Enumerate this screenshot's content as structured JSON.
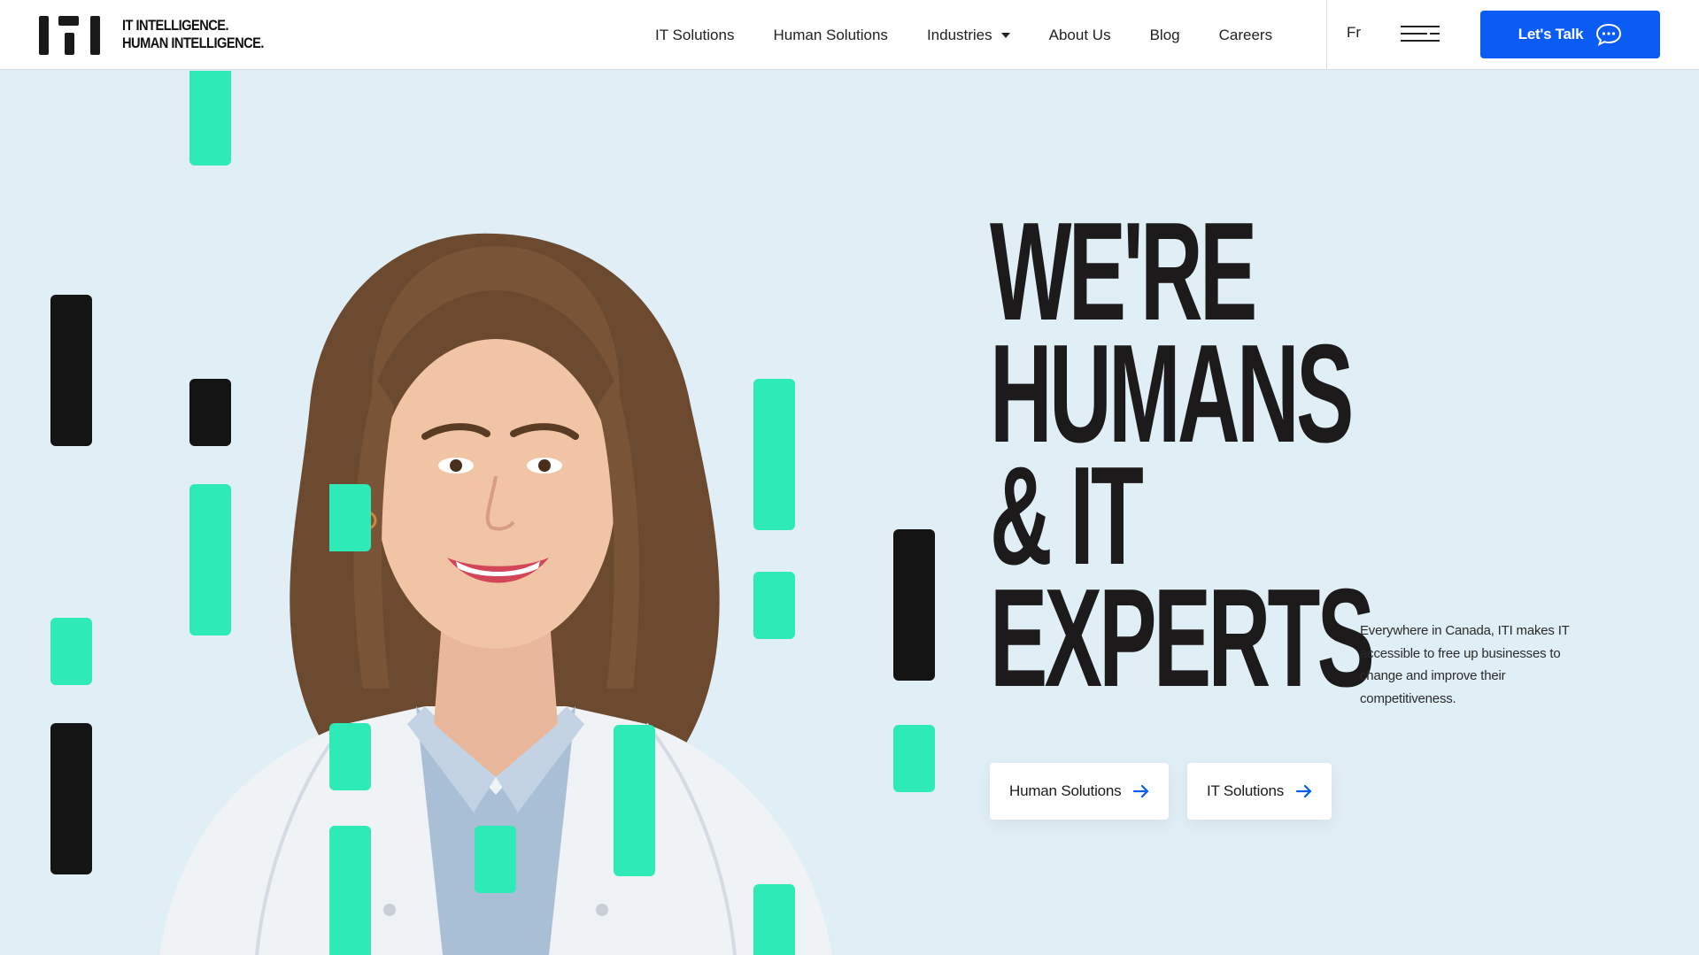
{
  "brand": {
    "line1": "IT INTELLIGENCE.",
    "line2": "HUMAN INTELLIGENCE."
  },
  "nav": {
    "items": [
      {
        "label": "IT Solutions"
      },
      {
        "label": "Human Solutions"
      },
      {
        "label": "Industries",
        "has_dropdown": true
      },
      {
        "label": "About Us"
      },
      {
        "label": "Blog"
      },
      {
        "label": "Careers"
      }
    ],
    "language": "Fr",
    "menu_icon": "hamburger-icon",
    "cta_label": "Let's Talk",
    "cta_icon": "chat-bubble-icon"
  },
  "hero": {
    "headline": [
      "WE'RE",
      "HUMANS",
      "& IT",
      "EXPERTS"
    ],
    "tagline": "Everywhere in Canada, ITI makes IT accessible to free up businesses to change and improve their competitiveness.",
    "buttons": [
      {
        "label": "Human Solutions",
        "icon": "arrow-right-icon"
      },
      {
        "label": "IT Solutions",
        "icon": "arrow-right-icon"
      }
    ]
  },
  "colors": {
    "accent_blue": "#0b5cf5",
    "mint": "#2eeab7",
    "background": "#e0eef6",
    "dark": "#141414"
  }
}
